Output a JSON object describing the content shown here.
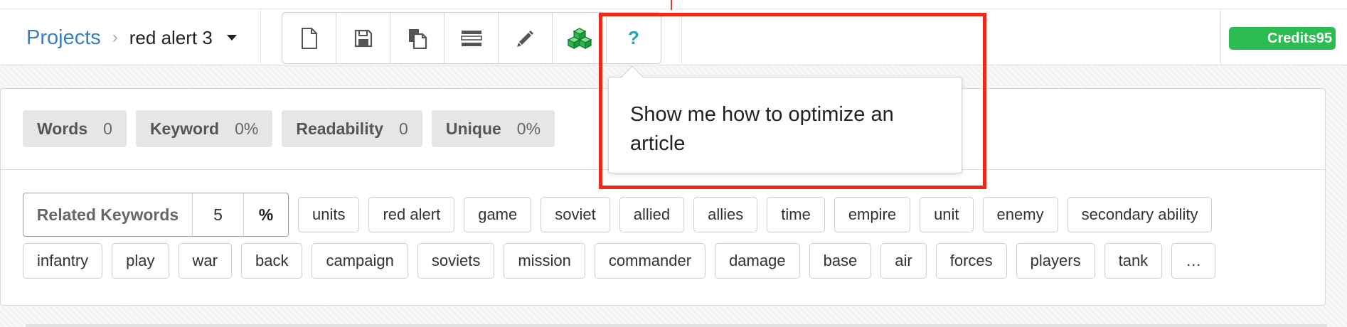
{
  "breadcrumb": {
    "root": "Projects",
    "separator": "›",
    "current": "red alert 3",
    "dropdown_icon": "chevron-down-icon"
  },
  "toolbar": {
    "buttons": [
      {
        "name": "new-document",
        "icon": "file-icon"
      },
      {
        "name": "save",
        "icon": "floppy-disk-icon"
      },
      {
        "name": "copy",
        "icon": "copy-documents-icon"
      },
      {
        "name": "outline",
        "icon": "list-bars-icon"
      },
      {
        "name": "edit",
        "icon": "pencil-icon"
      },
      {
        "name": "cubes",
        "icon": "green-cubes-icon"
      },
      {
        "name": "help",
        "icon": "question-mark-icon",
        "glyph": "?"
      }
    ]
  },
  "credits": {
    "label": "Credits",
    "value": "95",
    "color": "#2bbd52"
  },
  "metrics": [
    {
      "label": "Words",
      "value": "0"
    },
    {
      "label": "Keyword",
      "value": "0%"
    },
    {
      "label": "Readability",
      "value": "0"
    },
    {
      "label": "Unique",
      "value": "0%"
    }
  ],
  "keywords": {
    "label": "Related Keywords",
    "count": "5",
    "percent_label": "%",
    "row1": [
      "units",
      "red alert",
      "game",
      "soviet",
      "allied",
      "allies",
      "time",
      "empire",
      "unit",
      "enemy",
      "secondary ability"
    ],
    "row2": [
      "infantry",
      "play",
      "war",
      "back",
      "campaign",
      "soviets",
      "mission",
      "commander",
      "damage",
      "base",
      "air",
      "forces",
      "players",
      "tank",
      "…"
    ]
  },
  "tooltip": {
    "text": "Show me how to optimize an article"
  },
  "colors": {
    "link": "#3a7ebf",
    "help_icon": "#1aa6b7",
    "highlight": "#ec2a1c"
  }
}
